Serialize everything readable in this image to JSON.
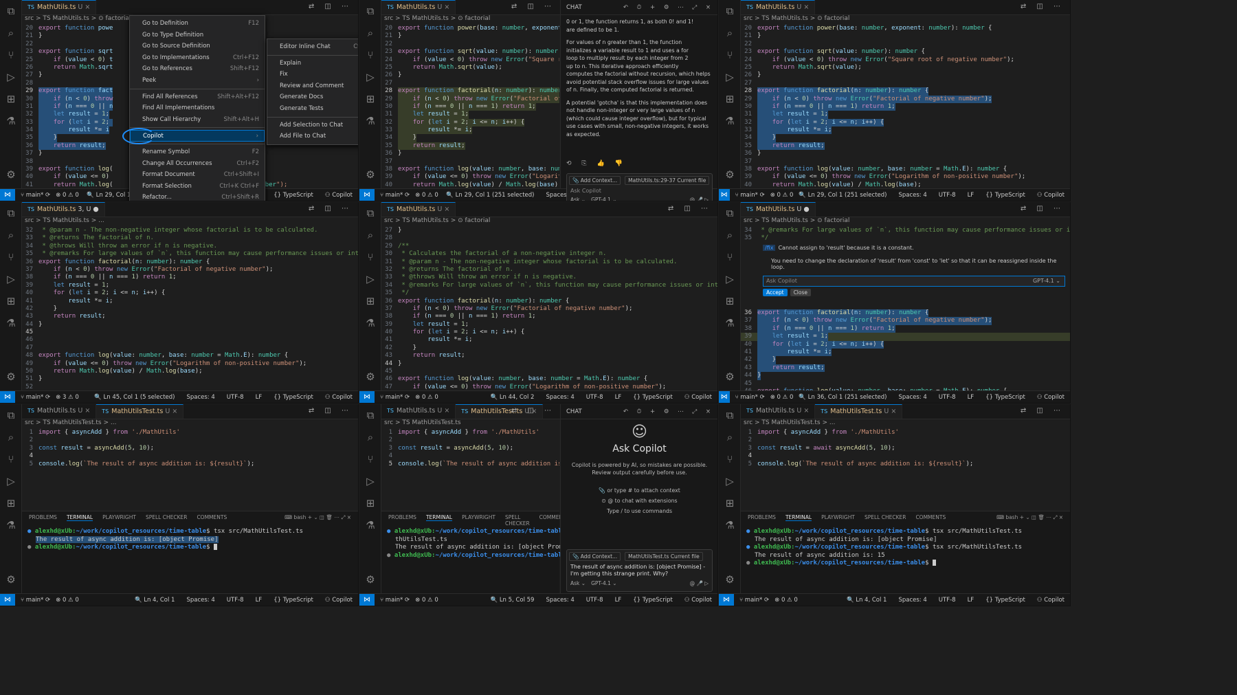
{
  "common": {
    "file_ts": "MathUtils.ts",
    "file_test": "MathUtilsTest.ts",
    "tab_mod": "U",
    "lang_badge": "TS",
    "branch": "main*",
    "problems": "⊗ 0 ⚠ 0",
    "spaces": "Spaces: 4",
    "enc": "UTF-8",
    "eol": "LF",
    "lang": "{} TypeScript",
    "copilot_status": "Copilot"
  },
  "p1": {
    "crumb": "src > TS MathUtils.ts > ⊙ factorial",
    "lines": [
      {
        "n": "20",
        "t": "export function powe"
      },
      {
        "n": "21",
        "t": "}"
      },
      {
        "n": "22",
        "t": ""
      },
      {
        "n": "23",
        "t": "export function sqrt"
      },
      {
        "n": "25",
        "t": "    if (value < 0) t"
      },
      {
        "n": "26",
        "t": "    return Math.sqrt"
      },
      {
        "n": "27",
        "t": "}"
      },
      {
        "n": "28",
        "t": ""
      },
      {
        "n": "29",
        "t": "export function fact"
      },
      {
        "n": "30",
        "t": "    if (n < 0) throw"
      },
      {
        "n": "31",
        "t": "    if (n === 0 || n"
      },
      {
        "n": "32",
        "t": "    let result = 1;"
      },
      {
        "n": "33",
        "t": "    for (let i = 2; "
      },
      {
        "n": "34",
        "t": "        result *= i"
      },
      {
        "n": "35",
        "t": "    }"
      },
      {
        "n": "36",
        "t": "    return result;"
      },
      {
        "n": "37",
        "t": "}"
      },
      {
        "n": "38",
        "t": ""
      },
      {
        "n": "39",
        "t": "export function log("
      },
      {
        "n": "40",
        "t": "    if (value <= 0) "
      },
      {
        "n": "41",
        "t": "    return Math.log("
      },
      {
        "n": "42",
        "t": "}"
      },
      {
        "n": "43",
        "t": ""
      }
    ],
    "right_lines": [
      "mber {",
      "",
      "",
      "",
      "",
      "",
      "",
      "",
      "",
      "",
      "",
      "",
      "",
      "",
      "",
      "",
      "",
      "",
      "",
      "number {",
      "itive number\");",
      "",
      ""
    ],
    "status_pos": "Ln 29, Col 1 (251 selected)",
    "context_menu": [
      {
        "label": "Go to Definition",
        "sc": "F12"
      },
      {
        "label": "Go to Type Definition",
        "sc": ""
      },
      {
        "label": "Go to Source Definition",
        "sc": ""
      },
      {
        "label": "Go to Implementations",
        "sc": "Ctrl+F12"
      },
      {
        "label": "Go to References",
        "sc": "Shift+F12"
      },
      {
        "label": "Peek",
        "sc": "›"
      },
      {
        "sep": true
      },
      {
        "label": "Find All References",
        "sc": "Shift+Alt+F12"
      },
      {
        "label": "Find All Implementations",
        "sc": ""
      },
      {
        "label": "Show Call Hierarchy",
        "sc": "Shift+Alt+H"
      },
      {
        "sep": true
      },
      {
        "label": "Copilot",
        "sc": "›",
        "sel": true
      },
      {
        "sep": true
      },
      {
        "label": "Rename Symbol",
        "sc": "F2"
      },
      {
        "label": "Change All Occurrences",
        "sc": "Ctrl+F2"
      },
      {
        "label": "Format Document",
        "sc": "Ctrl+Shift+I"
      },
      {
        "label": "Format Selection",
        "sc": "Ctrl+K Ctrl+F"
      },
      {
        "label": "Refactor...",
        "sc": "Ctrl+Shift+R"
      },
      {
        "label": "Source Action...",
        "sc": ""
      },
      {
        "sep": true
      },
      {
        "label": "Share",
        "sc": "›"
      }
    ],
    "submenu": [
      {
        "label": "Editor Inline Chat",
        "sc": "Ctrl+I"
      },
      {
        "sep": true
      },
      {
        "label": "Explain",
        "sc": ""
      },
      {
        "label": "Fix",
        "sc": ""
      },
      {
        "label": "Review and Comment",
        "sc": ""
      },
      {
        "label": "Generate Docs",
        "sc": ""
      },
      {
        "label": "Generate Tests",
        "sc": ""
      },
      {
        "sep": true
      },
      {
        "label": "Add Selection to Chat",
        "sc": ""
      },
      {
        "label": "Add File to Chat",
        "sc": ""
      }
    ]
  },
  "p2": {
    "crumb": "src > TS MathUtils.ts > ⊙ factorial",
    "lines": [
      {
        "n": "20",
        "t": "export function power(base: number, exponent: numbe"
      },
      {
        "n": "21",
        "t": "}"
      },
      {
        "n": "22",
        "t": ""
      },
      {
        "n": "23",
        "t": "export function sqrt(value: number): number {"
      },
      {
        "n": "24",
        "t": "    if (value < 0) throw new Error(\"Square root of n"
      },
      {
        "n": "25",
        "t": "    return Math.sqrt(value);"
      },
      {
        "n": "26",
        "t": "}"
      },
      {
        "n": "27",
        "t": ""
      },
      {
        "n": "28",
        "t": "export function factorial(n: number): number {"
      },
      {
        "n": "29",
        "t": "    if (n < 0) throw new Error(\"Factorial of negative"
      },
      {
        "n": "30",
        "t": "    if (n === 0 || n === 1) return 1;"
      },
      {
        "n": "31",
        "t": "    let result = 1;"
      },
      {
        "n": "32",
        "t": "    for (let i = 2; i <= n; i++) {"
      },
      {
        "n": "33",
        "t": "        result *= i;"
      },
      {
        "n": "34",
        "t": "    }"
      },
      {
        "n": "35",
        "t": "    return result;"
      },
      {
        "n": "36",
        "t": "}"
      },
      {
        "n": "37",
        "t": ""
      },
      {
        "n": "38",
        "t": "export function log(value: number, base: number = Mat"
      },
      {
        "n": "39",
        "t": "    if (value <= 0) throw new Error(\"Logarithm of non"
      },
      {
        "n": "40",
        "t": "    return Math.log(value) / Math.log(base);"
      },
      {
        "n": "41",
        "t": "}"
      },
      {
        "n": "42",
        "t": ""
      }
    ],
    "chat_title": "CHAT",
    "chat_text": [
      "0 or 1, the function returns 1, as both 0! and 1!",
      "are defined to be 1.",
      "",
      "For values of n greater than 1, the function",
      "initializes a variable result to 1 and uses a for",
      "loop to multiply result by each integer from 2",
      "up to n. This iterative approach efficiently",
      "computes the factorial without recursion, which helps",
      "avoid potential stack overflow issues for large values",
      "of n. Finally, the computed factorial is returned.",
      "",
      "A potential 'gotcha' is that this implementation does",
      "not handle non-integer or very large values of n",
      "(which could cause integer overflow), but for typical",
      "use cases with small, non-negative integers, it works",
      "as expected."
    ],
    "add_context": "Add Context...",
    "current_file": "MathUtils.ts:29-37 Current file",
    "placeholder": "Ask Copilot",
    "mode": "Ask ⌄",
    "model": "GPT-4.1 ⌄",
    "status_pos": "Ln 29, Col 1 (251 selected)"
  },
  "p3": {
    "crumb": "src > TS MathUtils.ts > ⊙ factorial",
    "lines": [
      {
        "n": "20",
        "t": "export function power(base: number, exponent: number): number {"
      },
      {
        "n": "21",
        "t": "}"
      },
      {
        "n": "22",
        "t": ""
      },
      {
        "n": "23",
        "t": "export function sqrt(value: number): number {"
      },
      {
        "n": "24",
        "t": "    if (value < 0) throw new Error(\"Square root of negative number\");"
      },
      {
        "n": "25",
        "t": "    return Math.sqrt(value);"
      },
      {
        "n": "26",
        "t": "}"
      },
      {
        "n": "27",
        "t": ""
      },
      {
        "n": "28",
        "t": "export function factorial(n: number): number {"
      },
      {
        "n": "29",
        "t": "    if (n < 0) throw new Error(\"Factorial of negative number\");"
      },
      {
        "n": "30",
        "t": "    if (n === 0 || n === 1) return 1;"
      },
      {
        "n": "31",
        "t": "    let result = 1;"
      },
      {
        "n": "32",
        "t": "    for (let i = 2; i <= n; i++) {"
      },
      {
        "n": "33",
        "t": "        result *= i;"
      },
      {
        "n": "34",
        "t": "    }"
      },
      {
        "n": "35",
        "t": "    return result;"
      },
      {
        "n": "36",
        "t": "}"
      },
      {
        "n": "37",
        "t": ""
      },
      {
        "n": "38",
        "t": "export function log(value: number, base: number = Math.E): number {"
      },
      {
        "n": "39",
        "t": "    if (value <= 0) throw new Error(\"Logarithm of non-positive number\");"
      },
      {
        "n": "40",
        "t": "    return Math.log(value) / Math.log(base);"
      },
      {
        "n": "41",
        "t": "}"
      },
      {
        "n": "42",
        "t": ""
      }
    ],
    "status_pos": "Ln 29, Col 1 (251 selected)"
  },
  "p4": {
    "tab": "MathUtils.ts 3, U",
    "crumb": "src > TS MathUtils.ts > ...",
    "lines": [
      {
        "n": "32",
        "t": " * @param n - The non-negative integer whose factorial is to be calculated."
      },
      {
        "n": "33",
        "t": " * @returns The factorial of n."
      },
      {
        "n": "34",
        "t": " * @throws Will throw an error if n is negative."
      },
      {
        "n": "35",
        "t": " * @remarks For large values of `n`, this function may cause performance issues or integer ove"
      },
      {
        "n": "36",
        "t": "export function factorial(n: number): number {"
      },
      {
        "n": "37",
        "t": "    if (n < 0) throw new Error(\"Factorial of negative number\");"
      },
      {
        "n": "38",
        "t": "    if (n === 0 || n === 1) return 1;"
      },
      {
        "n": "39",
        "t": "    let result = 1;"
      },
      {
        "n": "40",
        "t": "    for (let i = 2; i <= n; i++) {"
      },
      {
        "n": "41",
        "t": "        result *= i;"
      },
      {
        "n": "42",
        "t": "    }"
      },
      {
        "n": "43",
        "t": "    return result;"
      },
      {
        "n": "44",
        "t": "}"
      },
      {
        "n": "45",
        "t": ""
      },
      {
        "n": "46",
        "t": ""
      },
      {
        "n": "47",
        "t": ""
      },
      {
        "n": "48",
        "t": "export function log(value: number, base: number = Math.E): number {"
      },
      {
        "n": "49",
        "t": "    if (value <= 0) throw new Error(\"Logarithm of non-positive number\");"
      },
      {
        "n": "50",
        "t": "    return Math.log(value) / Math.log(base);"
      },
      {
        "n": "51",
        "t": "}"
      },
      {
        "n": "52",
        "t": ""
      },
      {
        "n": "53",
        "t": "export async function asyncAdd(a: number, b: number): Promise<number> {"
      }
    ],
    "status_pos": "Ln 45, Col 1 (5 selected)",
    "problems": "⊗ 3 ⚠ 0"
  },
  "p5": {
    "crumb": "src > TS MathUtils.ts > ⊙ factorial",
    "lines": [
      {
        "n": "27",
        "t": "}"
      },
      {
        "n": "28",
        "t": ""
      },
      {
        "n": "29",
        "t": "/**"
      },
      {
        "n": "30",
        "t": " * Calculates the factorial of a non-negative integer n."
      },
      {
        "n": "31",
        "t": " * @param n - The non-negative integer whose factorial is to be calculated."
      },
      {
        "n": "32",
        "t": " * @returns The factorial of n."
      },
      {
        "n": "33",
        "t": " * @throws Will throw an error if n is negative."
      },
      {
        "n": "34",
        "t": " * @remarks For large values of `n`, this function may cause performance issues or integer ove"
      },
      {
        "n": "35",
        "t": " */"
      },
      {
        "n": "36",
        "t": "export function factorial(n: number): number {"
      },
      {
        "n": "37",
        "t": "    if (n < 0) throw new Error(\"Factorial of negative number\");"
      },
      {
        "n": "38",
        "t": "    if (n === 0 || n === 1) return 1;"
      },
      {
        "n": "39",
        "t": "    let result = 1;"
      },
      {
        "n": "40",
        "t": "    for (let i = 2; i <= n; i++) {"
      },
      {
        "n": "41",
        "t": "        result *= i;"
      },
      {
        "n": "42",
        "t": "    }"
      },
      {
        "n": "43",
        "t": "    return result;"
      },
      {
        "n": "44",
        "t": "}"
      },
      {
        "n": "45",
        "t": ""
      },
      {
        "n": "46",
        "t": "export function log(value: number, base: number = Math.E): number {"
      },
      {
        "n": "47",
        "t": "    if (value <= 0) throw new Error(\"Logarithm of non-positive number\");"
      },
      {
        "n": "48",
        "t": "    return Math.log(value) / Math.log(base);"
      },
      {
        "n": "49",
        "t": "}"
      }
    ],
    "status_pos": "Ln 44, Col 2"
  },
  "p6": {
    "crumb": "src > TS MathUtils.ts > ⊙ factorial",
    "top_lines": [
      {
        "n": "34",
        "t": " * @remarks For large values of `n`, this function may cause performance issues or integer ove"
      },
      {
        "n": "35",
        "t": " */"
      }
    ],
    "fix_cmd": "/fix",
    "fix_msg": "Cannot assign to 'result' because it is a constant.",
    "fix_answer": "You need to change the declaration of 'result' from 'const' to 'let' so that it can be reassigned inside the loop.",
    "placeholder": "Ask Copilot",
    "model": "GPT-4.1 ⌄",
    "accept": "Accept",
    "close": "Close",
    "lines": [
      {
        "n": "36",
        "t": "export function factorial(n: number): number {"
      },
      {
        "n": "37",
        "t": "    if (n < 0) throw new Error(\"Factorial of negative number\");"
      },
      {
        "n": "38",
        "t": "    if (n === 0 || n === 1) return 1;"
      },
      {
        "n": "39",
        "t": "    let result = 1;"
      },
      {
        "n": "40",
        "t": "    for (let i = 2; i <= n; i++) {"
      },
      {
        "n": "41",
        "t": "        result *= i;"
      },
      {
        "n": "42",
        "t": "    }"
      },
      {
        "n": "43",
        "t": "    return result;"
      },
      {
        "n": "44",
        "t": "}"
      },
      {
        "n": "45",
        "t": ""
      },
      {
        "n": "46",
        "t": "export function log(value: number, base: number = Math.E): number {"
      },
      {
        "n": "47",
        "t": "    if (value <= 0) throw new Error(\"Logarithm of non-positive number\");"
      },
      {
        "n": "48",
        "t": "    return Math.log(value) / Math.log(base);"
      },
      {
        "n": "49",
        "t": "}"
      }
    ],
    "status_pos": "Ln 36, Col 1 (251 selected)"
  },
  "p7": {
    "crumb": "src > TS MathUtilsTest.ts > ...",
    "lines": [
      {
        "n": "1",
        "t": "import { asyncAdd } from './MathUtils'"
      },
      {
        "n": "2",
        "t": ""
      },
      {
        "n": "3",
        "t": "const result = asyncAdd(5, 10);"
      },
      {
        "n": "4",
        "t": ""
      },
      {
        "n": "5",
        "t": "console.log(`The result of async addition is: ${result}`);"
      }
    ],
    "terminal": [
      "alexhd@xUb:~/work/copilot_resources/time-table$ tsx src/MathUtilsTest.ts",
      "The result of async addition is: [object Promise]",
      "alexhd@xUb:~/work/copilot_resources/time-table$ "
    ],
    "status_pos": "Ln 4, Col 1"
  },
  "p8": {
    "crumb": "src > TS MathUtilsTest.ts",
    "lines": [
      {
        "n": "1",
        "t": "import { asyncAdd } from './MathUtils'"
      },
      {
        "n": "2",
        "t": ""
      },
      {
        "n": "3",
        "t": "const result = asyncAdd(5, 10);"
      },
      {
        "n": "4",
        "t": ""
      },
      {
        "n": "5",
        "t": "console.log(`The result of async addition is: ${resul"
      }
    ],
    "terminal": [
      "alexhd@xUb:~/work/copilot_resources/time-table$ tsx src/Ma",
      "thUtilsTest.ts",
      "The result of async addition is: [object Promise]",
      "alexhd@xUb:~/work/copilot_resources/time-table$ "
    ],
    "chat_title": "CHAT",
    "ask_title": "Ask Copilot",
    "disclaimer": "Copilot is powered by AI, so mistakes are possible. Review output carefully before use.",
    "hint1": "or type # to attach context",
    "hint2": "@ to chat with extensions",
    "hint3": "Type / to use commands",
    "add_context": "Add Context...",
    "current_file": "MathUtilsTest.ts Current file",
    "question": "The result of async addition is: [object Promise] - I'm getting this strange print. Why?",
    "mode": "Ask ⌄",
    "model": "GPT-4.1 ⌄",
    "status_pos": "Ln 5, Col 59"
  },
  "p9": {
    "crumb": "src > TS MathUtilsTest.ts > ...",
    "lines": [
      {
        "n": "1",
        "t": "import { asyncAdd } from './MathUtils'"
      },
      {
        "n": "2",
        "t": ""
      },
      {
        "n": "3",
        "t": "const result = await asyncAdd(5, 10);"
      },
      {
        "n": "4",
        "t": ""
      },
      {
        "n": "5",
        "t": "console.log(`The result of async addition is: ${result}`);"
      }
    ],
    "terminal": [
      "alexhd@xUb:~/work/copilot_resources/time-table$ tsx src/MathUtilsTest.ts",
      "The result of async addition is: [object Promise]",
      "alexhd@xUb:~/work/copilot_resources/time-table$ tsx src/MathUtilsTest.ts",
      "The result of async addition is: 15",
      "alexhd@xUb:~/work/copilot_resources/time-table$ "
    ],
    "status_pos": "Ln 4, Col 1"
  },
  "term_tabs": [
    "PROBLEMS",
    "TERMINAL",
    "PLAYWRIGHT",
    "SPELL CHECKER",
    "COMMENTS"
  ],
  "term_shell": "bash"
}
